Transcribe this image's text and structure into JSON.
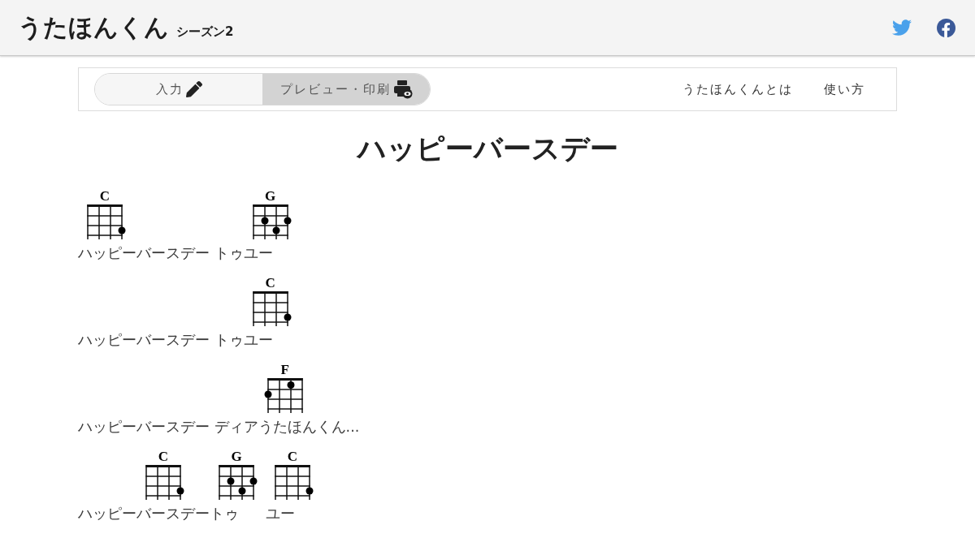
{
  "header": {
    "logo": "うたほんくん",
    "subtitle": "シーズン2"
  },
  "toolbar": {
    "tabs": [
      {
        "label": "入力",
        "selected": false
      },
      {
        "label": "プレビュー・印刷",
        "selected": true
      }
    ],
    "links": [
      "うたほんくんとは",
      "使い方"
    ]
  },
  "song": {
    "title": "ハッピーバースデー",
    "lines": [
      {
        "segments": [
          {
            "chord": {
              "name": "C",
              "frets": [
                [
                  false,
                  false,
                  false,
                  false
                ],
                [
                  false,
                  false,
                  false,
                  false
                ],
                [
                  false,
                  false,
                  false,
                  true
                ]
              ]
            },
            "lyric": "ハッピーバースデー トゥ"
          },
          {
            "chord": {
              "name": "G",
              "frets": [
                [
                  false,
                  false,
                  false,
                  false
                ],
                [
                  false,
                  true,
                  false,
                  true
                ],
                [
                  false,
                  false,
                  true,
                  false
                ]
              ]
            },
            "lyric": "ユー"
          }
        ]
      },
      {
        "segments": [
          {
            "lyric": "ハッピーバースデー トゥ"
          },
          {
            "chord": {
              "name": "C",
              "frets": [
                [
                  false,
                  false,
                  false,
                  false
                ],
                [
                  false,
                  false,
                  false,
                  false
                ],
                [
                  false,
                  false,
                  false,
                  true
                ]
              ]
            },
            "lyric": "ユー"
          }
        ]
      },
      {
        "segments": [
          {
            "lyric": "ハッピーバースデー ディア"
          },
          {
            "chord": {
              "name": "F",
              "frets": [
                [
                  false,
                  false,
                  true,
                  false
                ],
                [
                  true,
                  false,
                  false,
                  false
                ],
                [
                  false,
                  false,
                  false,
                  false
                ]
              ]
            },
            "lyric": "うたほんくん..."
          }
        ]
      },
      {
        "segments": [
          {
            "lyric": "ハッピー"
          },
          {
            "chord": {
              "name": "C",
              "frets": [
                [
                  false,
                  false,
                  false,
                  false
                ],
                [
                  false,
                  false,
                  false,
                  false
                ],
                [
                  false,
                  false,
                  false,
                  true
                ]
              ]
            },
            "lyric": "バースデー"
          },
          {
            "chord": {
              "name": "G",
              "frets": [
                [
                  false,
                  false,
                  false,
                  false
                ],
                [
                  false,
                  true,
                  false,
                  true
                ],
                [
                  false,
                  false,
                  true,
                  false
                ]
              ]
            },
            "lyric": "トゥ"
          },
          {
            "chord": {
              "name": "C",
              "frets": [
                [
                  false,
                  false,
                  false,
                  false
                ],
                [
                  false,
                  false,
                  false,
                  false
                ],
                [
                  false,
                  false,
                  false,
                  true
                ]
              ]
            },
            "lyric": "ユー"
          }
        ]
      }
    ]
  }
}
